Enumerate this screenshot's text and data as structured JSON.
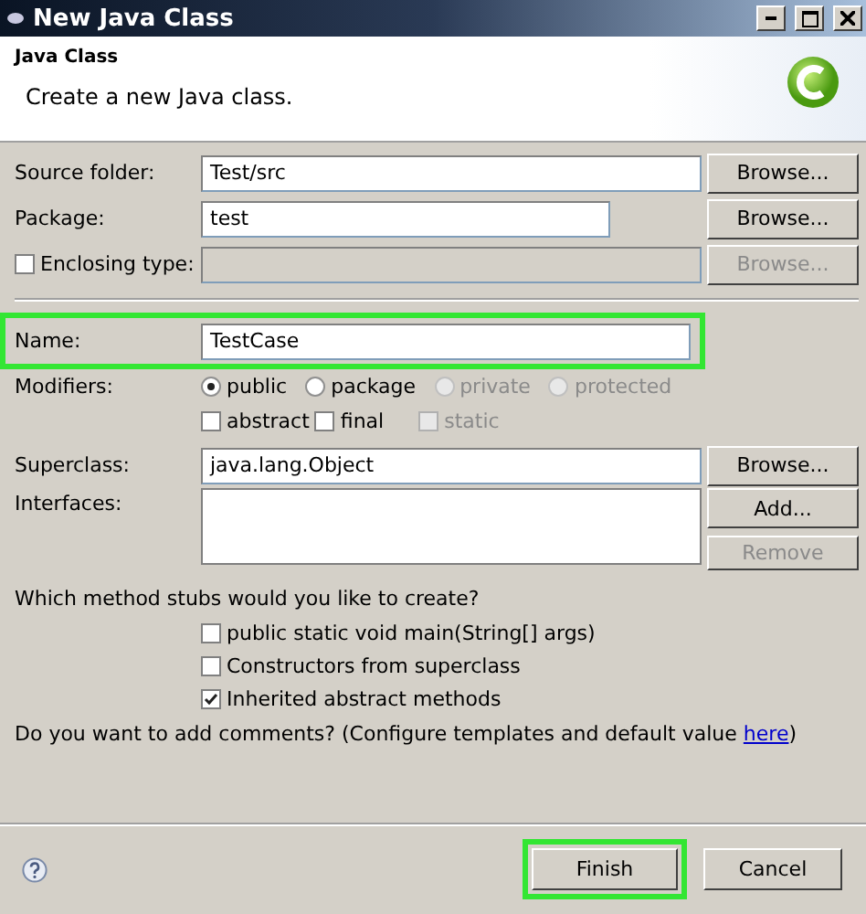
{
  "window": {
    "title": "New Java Class"
  },
  "header": {
    "title": "Java Class",
    "description": "Create a new Java class."
  },
  "location_rows": [
    {
      "label": "Source folder:",
      "value": "Test/src",
      "disabled": false,
      "button": {
        "label": "Browse...",
        "disabled": false
      }
    },
    {
      "label": "Package:",
      "value": "test",
      "short": true,
      "disabled": false,
      "button": {
        "label": "Browse...",
        "disabled": false
      }
    },
    {
      "label": "Enclosing type:",
      "checkbox": {
        "checked": false
      },
      "disabled": true,
      "button": {
        "label": "Browse...",
        "disabled": true
      }
    }
  ],
  "name": {
    "label": "Name:",
    "value": "TestCase",
    "highlighted": true
  },
  "modifiers": {
    "label": "Modifiers:",
    "access": [
      {
        "label": "public",
        "selected": true,
        "disabled": false
      },
      {
        "label": "package",
        "selected": false,
        "disabled": false
      },
      {
        "label": "private",
        "selected": false,
        "disabled": true
      },
      {
        "label": "protected",
        "selected": false,
        "disabled": true
      }
    ],
    "flags": [
      {
        "label": "abstract",
        "checked": false,
        "disabled": false
      },
      {
        "label": "final",
        "checked": false,
        "disabled": false
      },
      {
        "label": "static",
        "checked": false,
        "disabled": true
      }
    ]
  },
  "superclass": {
    "label": "Superclass:",
    "value": "java.lang.Object",
    "button": {
      "label": "Browse...",
      "disabled": false
    }
  },
  "interfaces": {
    "label": "Interfaces:",
    "buttons": [
      {
        "label": "Add...",
        "disabled": false
      },
      {
        "label": "Remove",
        "disabled": true
      }
    ]
  },
  "stubs": {
    "question": "Which method stubs would you like to create?",
    "options": [
      {
        "label": "public static void main(String[] args)",
        "checked": false
      },
      {
        "label": "Constructors from superclass",
        "checked": false
      },
      {
        "label": "Inherited abstract methods",
        "checked": true
      }
    ]
  },
  "comments": {
    "prefix": "Do you want to add comments? (Configure templates and default value ",
    "link": "here",
    "suffix": ")"
  },
  "footer": {
    "buttons": [
      {
        "label": "Finish",
        "highlighted": true
      },
      {
        "label": "Cancel",
        "highlighted": false
      }
    ]
  }
}
